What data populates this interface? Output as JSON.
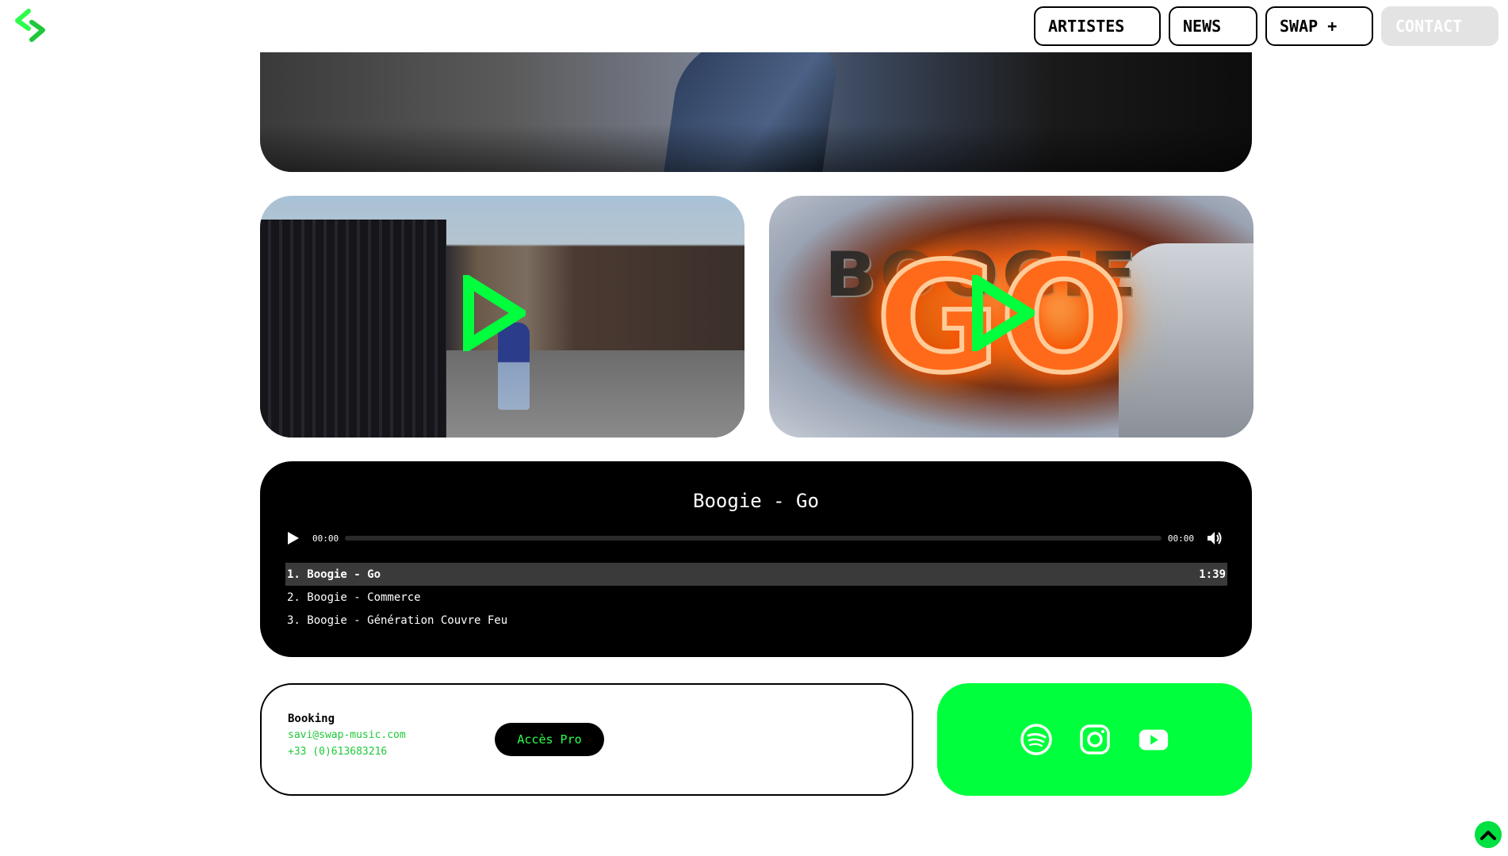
{
  "header": {
    "logo_icon": "swap-logo-icon",
    "nav": {
      "artistes": "ARTISTES",
      "news": "NEWS",
      "swap": "SWAP +",
      "contact": "CONTACT"
    }
  },
  "videos": [
    {
      "play_icon": "play-icon"
    },
    {
      "play_icon": "play-icon"
    }
  ],
  "player": {
    "title": "Boogie - Go",
    "current_time": "00:00",
    "duration": "00:00",
    "tracks": [
      {
        "label": "1. Boogie - Go",
        "length": "1:39"
      },
      {
        "label": "2. Boogie - Commerce",
        "length": ""
      },
      {
        "label": "3. Boogie - Génération Couvre Feu",
        "length": ""
      }
    ]
  },
  "booking": {
    "label": "Booking",
    "email": "savi@swap-music.com",
    "phone": "+33 (0)613683216",
    "button": "Accès Pro"
  },
  "socials": [
    "spotify-icon",
    "instagram-icon",
    "youtube-icon"
  ],
  "colors": {
    "accent_green": "#00ff3c",
    "text_green": "#1ec83a",
    "black": "#000000",
    "contact_bg": "#e3e3e3"
  }
}
